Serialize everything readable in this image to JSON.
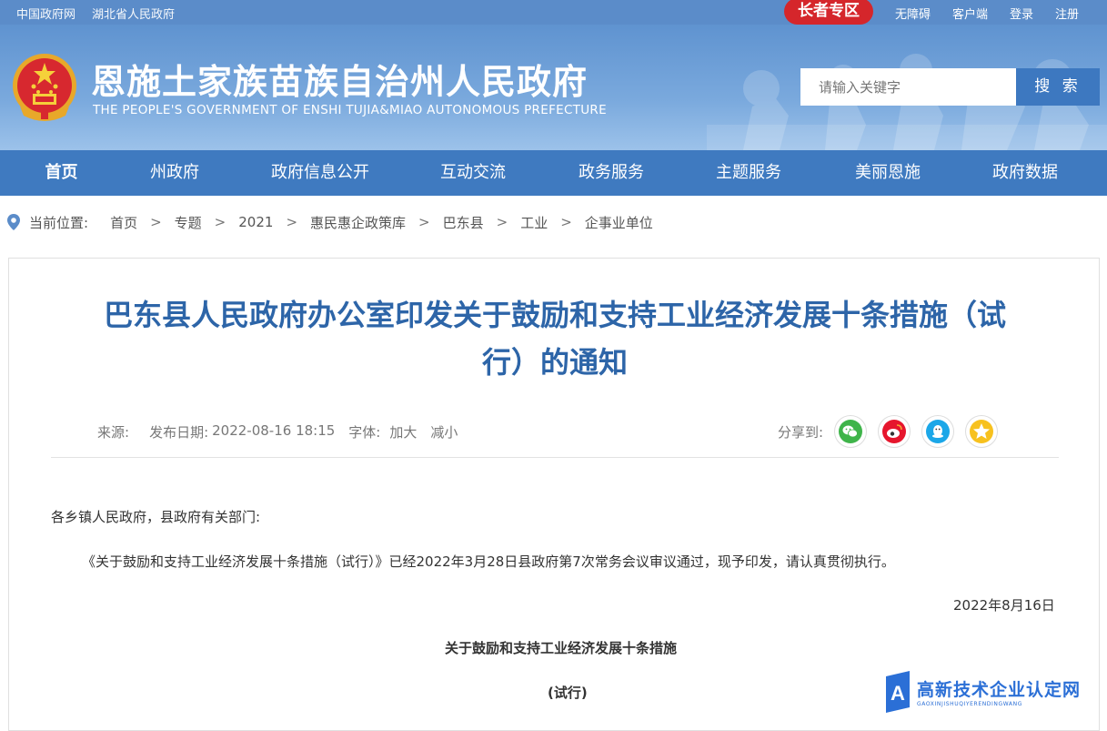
{
  "topbar": {
    "links_left": [
      "中国政府网",
      "湖北省人民政府"
    ],
    "elder_zone": "长者专区",
    "links_right": [
      "无障碍",
      "客户端",
      "登录",
      "注册"
    ]
  },
  "header": {
    "title": "恩施土家族苗族自治州人民政府",
    "subtitle": "THE PEOPLE'S GOVERNMENT OF ENSHI TUJIA&MIAO AUTONOMOUS PREFECTURE",
    "search_placeholder": "请输入关键字",
    "search_button": "搜 索"
  },
  "nav": [
    "首页",
    "州政府",
    "政府信息公开",
    "互动交流",
    "政务服务",
    "主题服务",
    "美丽恩施",
    "政府数据"
  ],
  "breadcrumb": {
    "label": "当前位置:",
    "items": [
      "首页",
      "专题",
      "2021",
      "惠民惠企政策库",
      "巴东县",
      "工业",
      "企事业单位"
    ],
    "separator": ">"
  },
  "article": {
    "title_line1": "巴东县人民政府办公室印发关于鼓励和支持工业经济发展十条措施（试",
    "title_line2": "行）的通知",
    "source_label": "来源:",
    "date_label": "发布日期:",
    "date_value": "2022-08-16 18:15",
    "font_label": "字体:",
    "font_larger": "加大",
    "font_smaller": "减小",
    "share_label": "分享到:",
    "share_icons": [
      "wechat-icon",
      "weibo-icon",
      "qq-icon",
      "qzone-icon"
    ],
    "salutation": "各乡镇人民政府，县政府有关部门:",
    "paragraph1": "《关于鼓励和支持工业经济发展十条措施（试行）》已经2022年3月28日县政府第7次常务会议审议通过，现予印发，请认真贯彻执行。",
    "sign_date": "2022年8月16日",
    "subtitle1": "关于鼓励和支持工业经济发展十条措施",
    "subtitle2": "(试行)"
  },
  "watermark": {
    "main": "高新技术企业认定网",
    "sub": "GAOXINJISHUQIYERENDINGWANG"
  },
  "colors": {
    "primary": "#3f7ac0",
    "title_blue": "#2d65a8",
    "elder_red": "#d5262b"
  }
}
